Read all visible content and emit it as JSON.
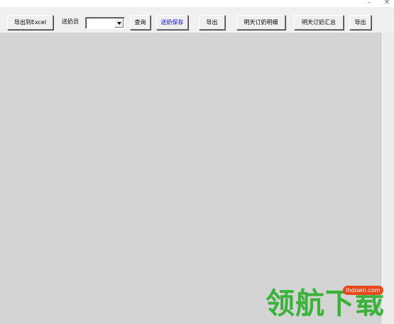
{
  "window": {
    "minimize_glyph": "–",
    "close_glyph": "✕"
  },
  "toolbar": {
    "export_excel_label": "导出到Excel",
    "deliverer_label": "送奶员",
    "deliverer_select": {
      "value": ""
    },
    "query_label": "查询",
    "save_delivery_label": "送奶保存",
    "export_label": "导出",
    "tomorrow_detail_label": "明天订奶明细",
    "tomorrow_summary_label": "明天订奶汇总",
    "export2_label": "导出"
  },
  "watermark": {
    "text": "领航下载",
    "badge": "lhdown.com"
  },
  "colors": {
    "workspace": "#d4d4d4",
    "save_text": "#0000cc",
    "watermark_text": "#3bb33b",
    "watermark_badge": "#e8481c"
  }
}
